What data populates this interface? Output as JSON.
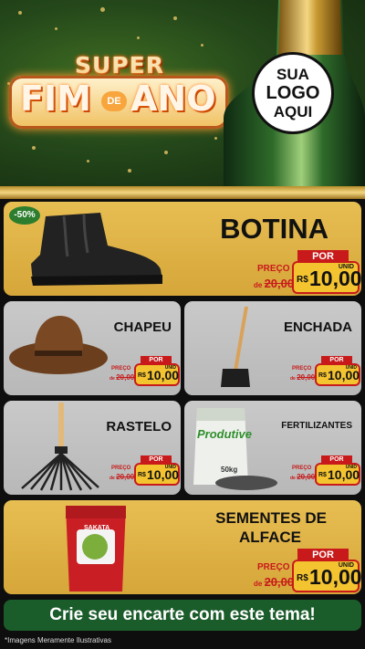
{
  "header": {
    "title_top": "SUPER",
    "title_left": "FIM",
    "title_connector": "DE",
    "title_right": "ANO",
    "logo_lines": [
      "SUA",
      "LOGO",
      "AQUI"
    ]
  },
  "featured": {
    "name": "BOTINA",
    "discount": "-50%",
    "por": "POR",
    "preco": "PREÇO",
    "de": "de",
    "old_price": "20,00",
    "currency": "R$",
    "price": "10,00",
    "unit": "UNID"
  },
  "products": [
    {
      "name": "CHAPEU",
      "por": "POR",
      "preco": "PREÇO",
      "de": "de",
      "old_price": "20,00",
      "currency": "R$",
      "price": "10,00",
      "unit": "UNID"
    },
    {
      "name": "ENCHADA",
      "por": "POR",
      "preco": "PREÇO",
      "de": "de",
      "old_price": "20,00",
      "currency": "R$",
      "price": "10,00",
      "unit": "UNID"
    },
    {
      "name": "RASTELO",
      "por": "POR",
      "preco": "PREÇO",
      "de": "de",
      "old_price": "20,00",
      "currency": "R$",
      "price": "10,00",
      "unit": "UNID"
    },
    {
      "name": "FERTILIZANTES",
      "por": "POR",
      "preco": "PREÇO",
      "de": "de",
      "old_price": "20,00",
      "currency": "R$",
      "price": "10,00",
      "unit": "UNID",
      "bag_brand": "Produtive",
      "bag_weight": "50kg"
    }
  ],
  "bottom_product": {
    "name_line1": "SEMENTES DE",
    "name_line2": "ALFACE",
    "brand": "SAKATA",
    "por": "POR",
    "preco": "PREÇO",
    "de": "de",
    "old_price": "20,00",
    "currency": "R$",
    "price": "10,00",
    "unit": "UNID"
  },
  "cta": "Crie seu encarte com este tema!",
  "footnote": "*Imagens Meramente Ilustrativas",
  "colors": {
    "gold": "#e7be52",
    "gray": "#c9c9c9",
    "green": "#1b5c2b",
    "red": "#c81a1a",
    "price_yellow": "#f4c430"
  }
}
